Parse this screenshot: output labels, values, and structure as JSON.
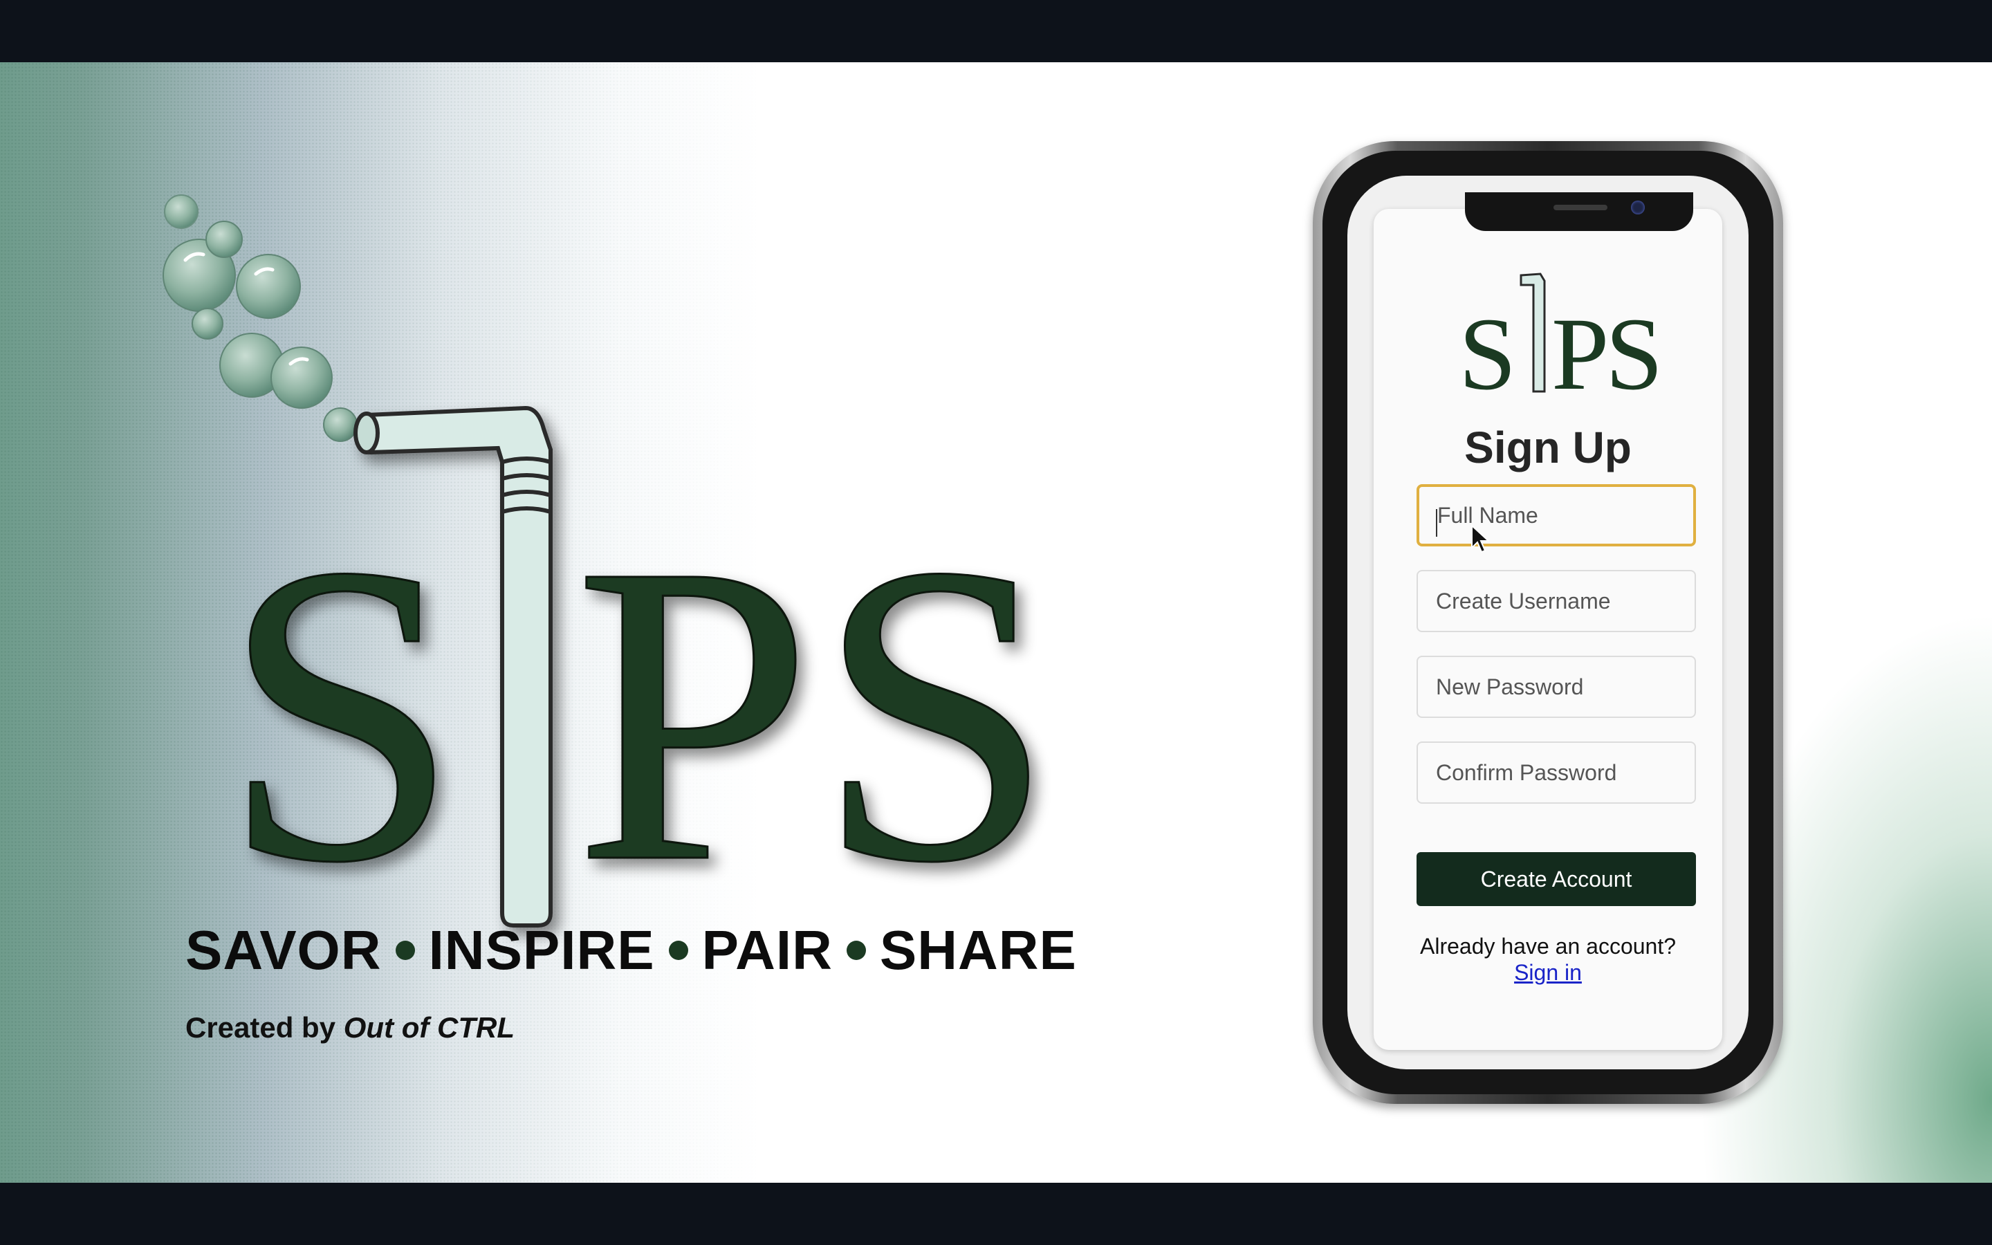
{
  "brand": {
    "logo_text": "SIPS",
    "tagline": [
      "SAVOR",
      "INSPIRE",
      "PAIR",
      "SHARE"
    ],
    "credit_prefix": "Created by ",
    "credit_name": "Out of CTRL"
  },
  "colors": {
    "brand_green": "#1b3a22",
    "button_green": "#132b1d",
    "focus_outline": "#e0b040",
    "link_blue": "#1a24c8"
  },
  "phone": {
    "title": "Sign Up",
    "fields": {
      "full_name_placeholder": "Full Name",
      "username_placeholder": "Create Username",
      "password_placeholder": "New Password",
      "confirm_placeholder": "Confirm Password"
    },
    "submit_label": "Create Account",
    "already_text": "Already have an account?",
    "signin_label": "Sign in"
  }
}
